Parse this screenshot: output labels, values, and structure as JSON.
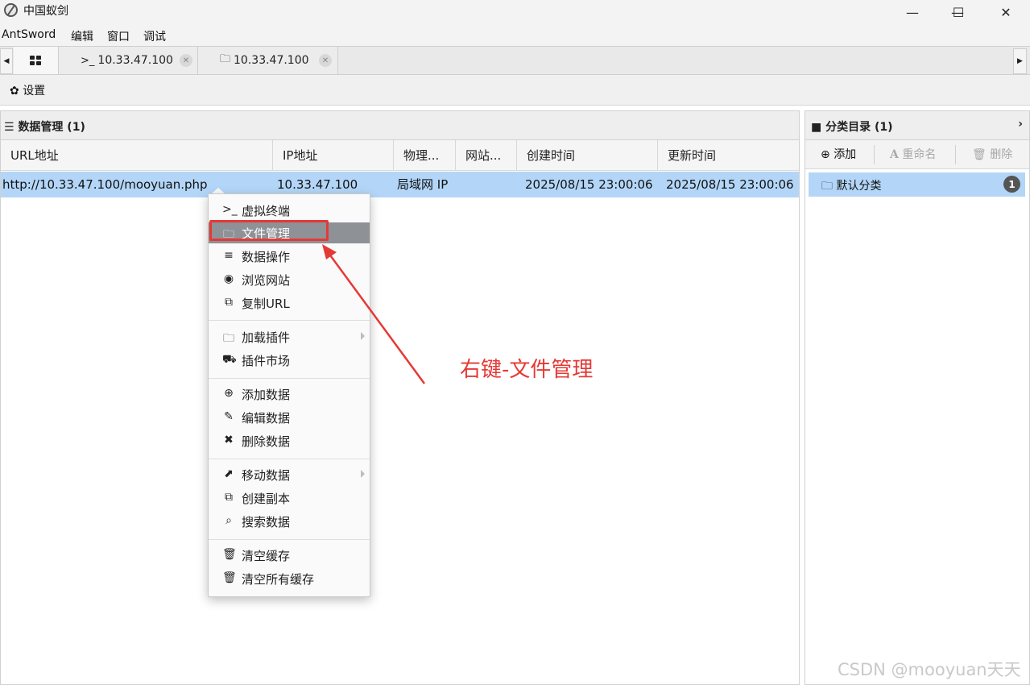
{
  "window": {
    "title": "中国蚁剑",
    "minimize": "—",
    "maximize": "☐",
    "close": "✕"
  },
  "menubar": {
    "items": [
      "AntSword",
      "编辑",
      "窗口",
      "调试"
    ]
  },
  "tabs": [
    {
      "icon": "terminal",
      "label": "10.33.47.100"
    },
    {
      "icon": "folder",
      "label": "10.33.47.100"
    }
  ],
  "toolbar": {
    "settings_label": "设置"
  },
  "data_panel": {
    "title": "数据管理 (1)",
    "columns": [
      "URL地址",
      "IP地址",
      "物理...",
      "网站...",
      "创建时间",
      "更新时间"
    ],
    "rows": [
      {
        "url": "http://10.33.47.100/mooyuan.php",
        "ip": "10.33.47.100",
        "location": "局域网 IP",
        "site": "",
        "created": "2025/08/15 23:00:06",
        "updated": "2025/08/15 23:00:06"
      }
    ]
  },
  "category_panel": {
    "title": "分类目录 (1)",
    "add_label": "添加",
    "rename_label": "重命名",
    "delete_label": "删除",
    "items": [
      {
        "label": "默认分类",
        "count": "1"
      }
    ]
  },
  "context_menu": {
    "groups": [
      [
        {
          "icon": "terminal",
          "label": "虚拟终端"
        },
        {
          "icon": "folder",
          "label": "文件管理",
          "active": true
        },
        {
          "icon": "database",
          "label": "数据操作"
        },
        {
          "icon": "chrome",
          "label": "浏览网站"
        },
        {
          "icon": "copy",
          "label": "复制URL"
        }
      ],
      [
        {
          "icon": "folder",
          "label": "加载插件",
          "submenu": true
        },
        {
          "icon": "cart",
          "label": "插件市场"
        }
      ],
      [
        {
          "icon": "plus-circle",
          "label": "添加数据"
        },
        {
          "icon": "edit",
          "label": "编辑数据"
        },
        {
          "icon": "times",
          "label": "删除数据"
        }
      ],
      [
        {
          "icon": "share",
          "label": "移动数据",
          "submenu": true
        },
        {
          "icon": "copy",
          "label": "创建副本"
        },
        {
          "icon": "search",
          "label": "搜索数据"
        }
      ],
      [
        {
          "icon": "trash",
          "label": "清空缓存"
        },
        {
          "icon": "trash",
          "label": "清空所有缓存"
        }
      ]
    ]
  },
  "annotation": {
    "text": "右键-文件管理",
    "color": "#e53935"
  },
  "watermark": "CSDN @mooyuan天天",
  "colors": {
    "selection": "#b3d6f8",
    "menu_active": "#8e9196",
    "annotation": "#e53935"
  }
}
